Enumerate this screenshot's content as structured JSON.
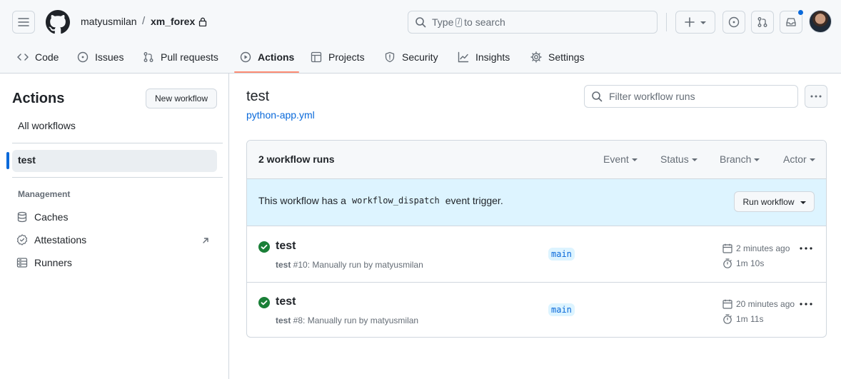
{
  "header": {
    "owner": "matyusmilan",
    "separator": "/",
    "repo": "xm_forex",
    "search": {
      "prefix": "Type",
      "key": "/",
      "suffix": "to search"
    }
  },
  "nav": {
    "tabs": [
      {
        "label": "Code",
        "icon": "code-icon"
      },
      {
        "label": "Issues",
        "icon": "issue-opened-icon"
      },
      {
        "label": "Pull requests",
        "icon": "git-pull-request-icon"
      },
      {
        "label": "Actions",
        "icon": "play-icon",
        "active": true
      },
      {
        "label": "Projects",
        "icon": "table-icon"
      },
      {
        "label": "Security",
        "icon": "shield-icon"
      },
      {
        "label": "Insights",
        "icon": "graph-icon"
      },
      {
        "label": "Settings",
        "icon": "gear-icon"
      }
    ]
  },
  "sidebar": {
    "title": "Actions",
    "new_workflow": "New workflow",
    "all_workflows": "All workflows",
    "active_workflow": "test",
    "section": "Management",
    "items": [
      {
        "label": "Caches",
        "icon": "database-icon"
      },
      {
        "label": "Attestations",
        "icon": "verified-icon"
      },
      {
        "label": "Runners",
        "icon": "server-icon"
      }
    ]
  },
  "main": {
    "title": "test",
    "file": "python-app.yml",
    "filter_placeholder": "Filter workflow runs",
    "runs_count": "2 workflow runs",
    "filters": [
      "Event",
      "Status",
      "Branch",
      "Actor"
    ],
    "flash": {
      "before": "This workflow has a",
      "code": "workflow_dispatch",
      "after": "event trigger.",
      "button": "Run workflow"
    },
    "runs": [
      {
        "title": "test",
        "workflow": "test",
        "meta": " #10: Manually run by matyusmilan",
        "branch": "main",
        "when": "2 minutes ago",
        "duration": "1m 10s",
        "status": "success"
      },
      {
        "title": "test",
        "workflow": "test",
        "meta": " #8: Manually run by matyusmilan",
        "branch": "main",
        "when": "20 minutes ago",
        "duration": "1m 11s",
        "status": "success"
      }
    ]
  },
  "colors": {
    "accent": "#0969da",
    "success": "#1a7f37",
    "tab_underline": "#fd8c73",
    "flash_bg": "#ddf4ff"
  }
}
